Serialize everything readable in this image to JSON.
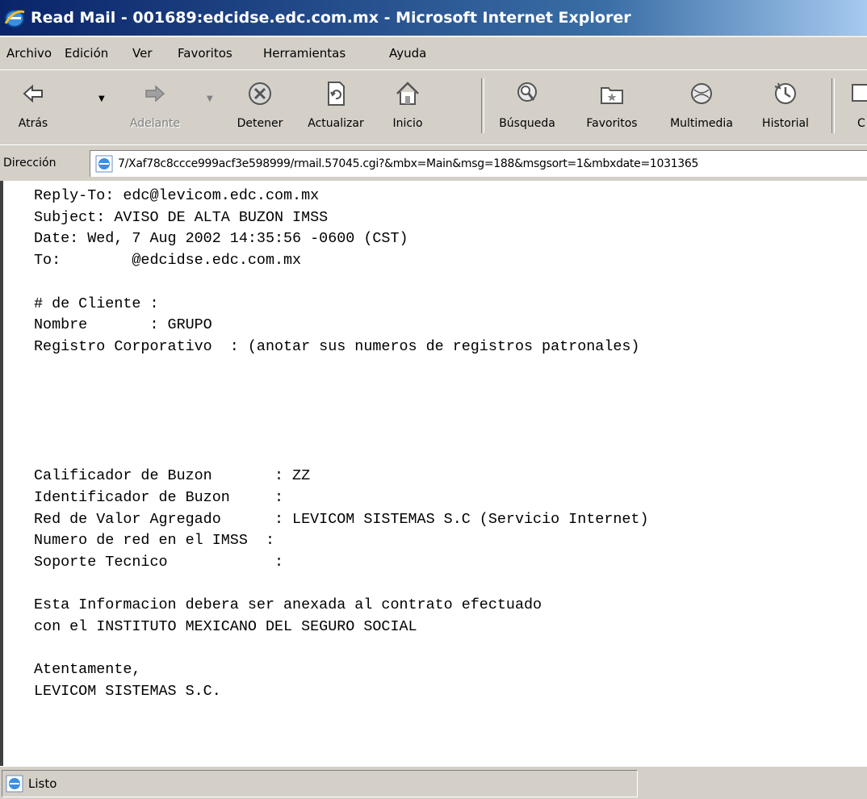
{
  "window": {
    "title": "Read Mail - 001689:edcidse.edc.com.mx - Microsoft Internet Explorer"
  },
  "menu": [
    "Archivo",
    "Edición",
    "Ver",
    "Favoritos",
    "Herramientas",
    "Ayuda"
  ],
  "toolbar": {
    "buttons": [
      {
        "label": "Atrás",
        "icon": "back-arrow-icon"
      },
      {
        "label": "Adelante",
        "icon": "forward-arrow-icon",
        "disabled": true
      },
      {
        "label": "Detener",
        "icon": "stop-icon"
      },
      {
        "label": "Actualizar",
        "icon": "refresh-icon"
      },
      {
        "label": "Inicio",
        "icon": "home-icon"
      },
      {
        "label": "Búsqueda",
        "icon": "search-icon"
      },
      {
        "label": "Favoritos",
        "icon": "favorites-icon"
      },
      {
        "label": "Multimedia",
        "icon": "media-icon"
      },
      {
        "label": "Historial",
        "icon": "history-icon"
      },
      {
        "label": "C",
        "icon": "mail-icon"
      }
    ]
  },
  "address": {
    "label": "Dirección",
    "url": "7/Xaf78c8ccce999acf3e598999/rmail.57045.cgi?&mbx=Main&msg=188&msgsort=1&mbxdate=1031365"
  },
  "mail": {
    "lines": [
      "Reply-To: edc@levicom.edc.com.mx",
      "Subject: AVISO DE ALTA BUZON IMSS",
      "Date: Wed, 7 Aug 2002 14:35:56 -0600 (CST)",
      "To:        @edcidse.edc.com.mx",
      "",
      "# de Cliente :",
      "Nombre       : GRUPO",
      "Registro Corporativo  : (anotar sus numeros de registros patronales)",
      "",
      "",
      "",
      "",
      "",
      "Calificador de Buzon       : ZZ",
      "Identificador de Buzon     :",
      "Red de Valor Agregado      : LEVICOM SISTEMAS S.C (Servicio Internet)",
      "Numero de red en el IMSS  :",
      "Soporte Tecnico            :",
      "",
      "Esta Informacion debera ser anexada al contrato efectuado",
      "con el INSTITUTO MEXICANO DEL SEGURO SOCIAL",
      "",
      "Atentamente,",
      "LEVICOM SISTEMAS S.C."
    ]
  },
  "status": {
    "text": "Listo"
  },
  "colors": {
    "titlebar_start": "#0a246a",
    "titlebar_end": "#a6caf0",
    "chrome": "#d4d0c8"
  }
}
